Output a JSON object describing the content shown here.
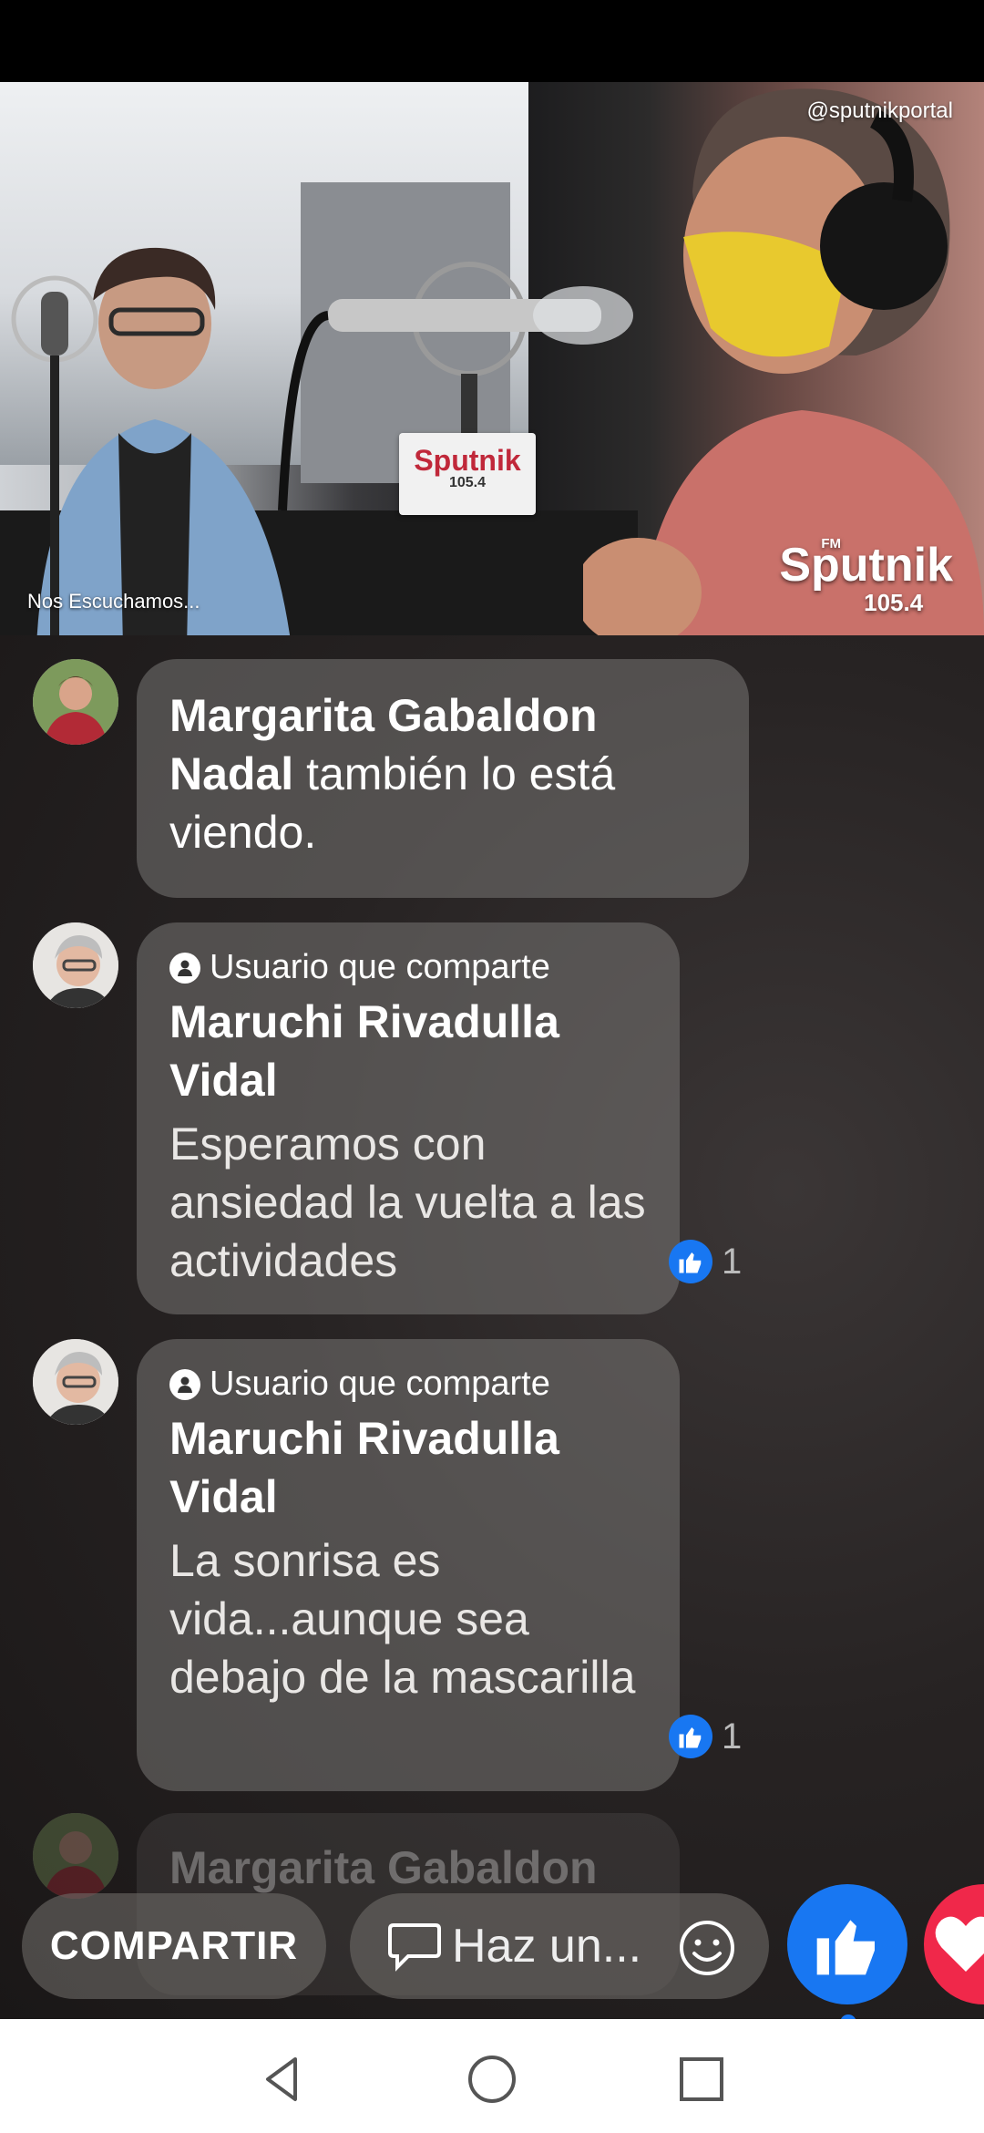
{
  "video": {
    "channel_handle": "@sputnikportal",
    "caption": "Nos Escuchamos...",
    "logo": {
      "fm": "FM",
      "name": "Sputnik",
      "freq": "105.4"
    },
    "mic_sign": {
      "name": "Sputnik",
      "freq": "105.4"
    }
  },
  "comments": [
    {
      "author": "Margarita Gabaldon Nadal",
      "joined_text": "también lo está viendo."
    },
    {
      "role": "Usuario que comparte",
      "author": "Maruchi Rivadulla Vidal",
      "text": "Esperamos con ansiedad  la vuelta a las actividades",
      "likes": "1"
    },
    {
      "role": "Usuario que comparte",
      "author": "Maruchi Rivadulla Vidal",
      "text": "La sonrisa es vida...aunque sea debajo de la mascarilla",
      "likes": "1"
    },
    {
      "author": "Margarita Gabaldon"
    }
  ],
  "bottom_bar": {
    "share_label": "COMPARTIR",
    "comment_placeholder": "Haz un..."
  },
  "colors": {
    "like_blue": "#1877f2",
    "heart_red": "#f0284a"
  },
  "icons": {
    "comment": "speech-bubble-icon",
    "emoji": "smiley-icon",
    "like": "thumbs-up-icon",
    "heart": "heart-icon",
    "nav_back": "triangle-back-icon",
    "nav_home": "circle-home-icon",
    "nav_recents": "square-recents-icon"
  }
}
